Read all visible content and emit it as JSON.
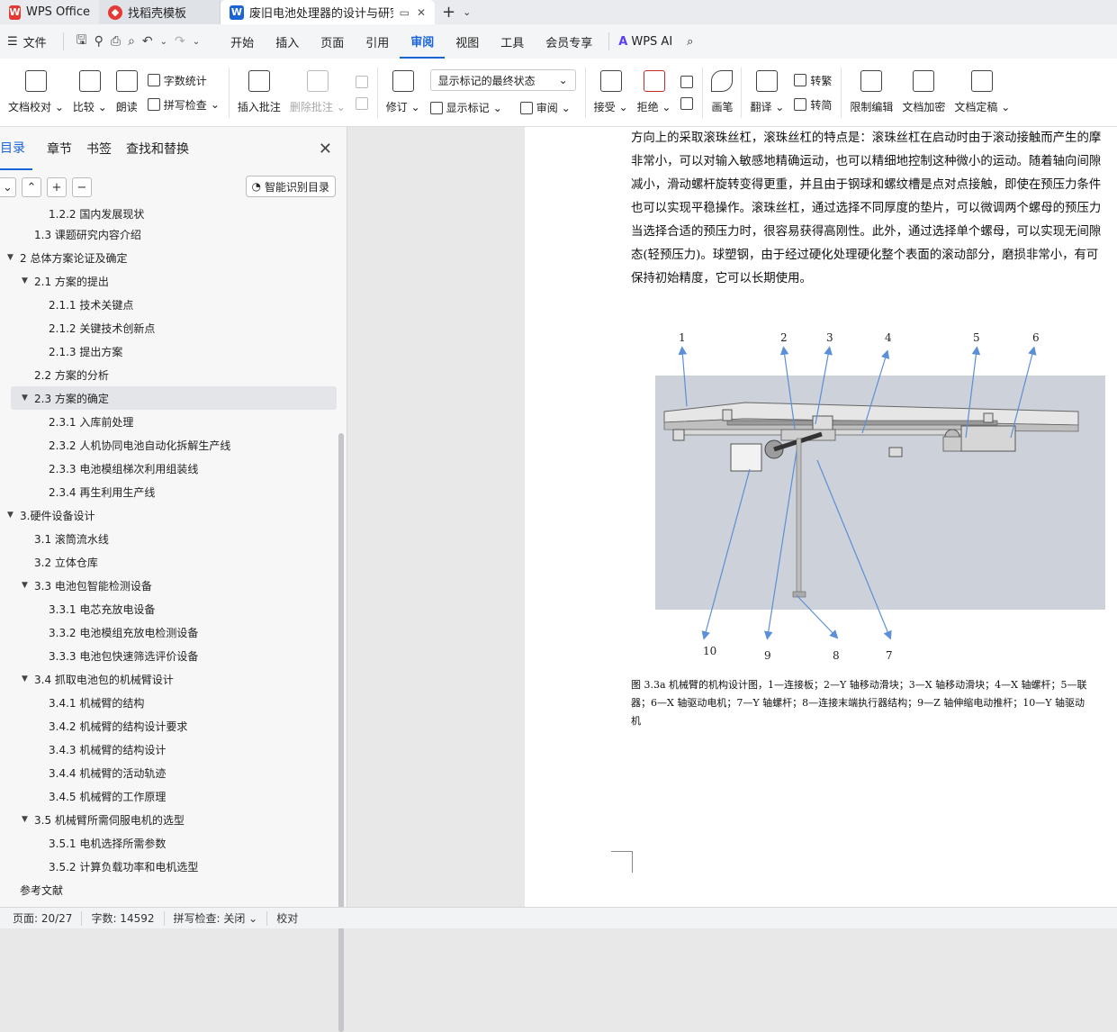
{
  "tabs": [
    {
      "label": "WPS Office",
      "icon": "wps-logo-icon"
    },
    {
      "label": "找稻壳模板",
      "icon": "docer-logo-icon"
    },
    {
      "label": "废旧电池处理器的设计与研究",
      "icon": "writer-logo-icon"
    }
  ],
  "menu": {
    "file": "文件",
    "items": [
      "开始",
      "插入",
      "页面",
      "引用",
      "审阅",
      "视图",
      "工具",
      "会员专享"
    ],
    "active": "审阅",
    "ai": "WPS AI"
  },
  "ribbon": {
    "doc_check": "文档校对",
    "compare": "比较",
    "read_aloud": "朗读",
    "word_count": "字数统计",
    "spell_check": "拼写检查",
    "insert_comment": "插入批注",
    "delete_comment": "删除批注",
    "revise": "修订",
    "markup_display": "显示标记的最终状态",
    "show_markup": "显示标记",
    "review": "审阅",
    "accept": "接受",
    "reject": "拒绝",
    "pen": "画笔",
    "translate": "翻译",
    "to_traditional": "转繁",
    "to_simplified": "转简",
    "restrict_edit": "限制编辑",
    "encrypt": "文档加密",
    "finalize": "文档定稿"
  },
  "nav": {
    "tabs": [
      "目录",
      "章节",
      "书签",
      "查找和替换"
    ],
    "active_tab": "目录",
    "smart_toc": "智能识别目录",
    "toc": [
      {
        "level": 3,
        "text": "1.2.2 国内发展现状",
        "arrow": false
      },
      {
        "level": 2,
        "text": "1.3  课题研究内容介绍",
        "arrow": false
      },
      {
        "level": 1,
        "text": "2  总体方案论证及确定",
        "arrow": true
      },
      {
        "level": 2,
        "text": "2.1 方案的提出",
        "arrow": true
      },
      {
        "level": 3,
        "text": "2.1.1 技术关键点",
        "arrow": false
      },
      {
        "level": 3,
        "text": "2.1.2 关键技术创新点",
        "arrow": false
      },
      {
        "level": 3,
        "text": "2.1.3 提出方案",
        "arrow": false
      },
      {
        "level": 2,
        "text": "2.2 方案的分析",
        "arrow": false
      },
      {
        "level": 2,
        "text": "2.3 方案的确定",
        "arrow": true,
        "selected": true
      },
      {
        "level": 3,
        "text": "2.3.1 入库前处理",
        "arrow": false
      },
      {
        "level": 3,
        "text": "2.3.2 人机协同电池自动化拆解生产线",
        "arrow": false
      },
      {
        "level": 3,
        "text": "2.3.3 电池模组梯次利用组装线",
        "arrow": false
      },
      {
        "level": 3,
        "text": "2.3.4 再生利用生产线",
        "arrow": false
      },
      {
        "level": 1,
        "text": "3.硬件设备设计",
        "arrow": true
      },
      {
        "level": 2,
        "text": "3.1 滚筒流水线",
        "arrow": false
      },
      {
        "level": 2,
        "text": "3.2 立体仓库",
        "arrow": false
      },
      {
        "level": 2,
        "text": "3.3 电池包智能检测设备",
        "arrow": true
      },
      {
        "level": 3,
        "text": "3.3.1 电芯充放电设备",
        "arrow": false
      },
      {
        "level": 3,
        "text": "3.3.2 电池模组充放电检测设备",
        "arrow": false
      },
      {
        "level": 3,
        "text": "3.3.3 电池包快速筛选评价设备",
        "arrow": false
      },
      {
        "level": 2,
        "text": "3.4 抓取电池包的机械臂设计",
        "arrow": true
      },
      {
        "level": 3,
        "text": "3.4.1 机械臂的结构",
        "arrow": false
      },
      {
        "level": 3,
        "text": "3.4.2 机械臂的结构设计要求",
        "arrow": false
      },
      {
        "level": 3,
        "text": "3.4.3 机械臂的结构设计",
        "arrow": false
      },
      {
        "level": 3,
        "text": "3.4.4 机械臂的活动轨迹",
        "arrow": false
      },
      {
        "level": 3,
        "text": "3.4.5 机械臂的工作原理",
        "arrow": false
      },
      {
        "level": 2,
        "text": "3.5 机械臂所需伺服电机的选型",
        "arrow": true
      },
      {
        "level": 3,
        "text": "3.5.1 电机选择所需参数",
        "arrow": false
      },
      {
        "level": 3,
        "text": "3.5.2 计算负载功率和电机选型",
        "arrow": false
      },
      {
        "level": 1,
        "text": "参考文献",
        "arrow": false
      }
    ]
  },
  "document": {
    "lines": [
      "方向上的采取滚珠丝杠，滚珠丝杠的特点是：滚珠丝杠在启动时由于滚动接触而产生的摩",
      "非常小，可以对输入敏感地精确运动，也可以精细地控制这种微小的运动。随着轴向间隙",
      "减小，滑动螺杆旋转变得更重，并且由于钢球和螺纹槽是点对点接触，即使在预压力条件",
      "也可以实现平稳操作。滚珠丝杠，通过选择不同厚度的垫片，可以微调两个螺母的预压力",
      "当选择合适的预压力时，很容易获得高刚性。此外，通过选择单个螺母，可以实现无间隙",
      "态(轻预压力)。球塑钢，由于经过硬化处理硬化整个表面的滚动部分，磨损非常小，有可",
      "保持初始精度，它可以长期使用。"
    ],
    "figure_labels_top": [
      "1",
      "2",
      "3",
      "4",
      "5",
      "6"
    ],
    "figure_labels_bottom": [
      "10",
      "9",
      "8",
      "7"
    ],
    "caption": [
      "图 3.3a  机械臂的机构设计图，1—连接板；2—Y 轴移动滑块；3—X 轴移动滑块；4—X 轴螺杆；5—联",
      "器；6—X 轴驱动电机；7—Y 轴螺杆；8—连接末端执行器结构；9—Z 轴伸缩电动推杆；10—Y 轴驱动",
      "机"
    ]
  },
  "status": {
    "page": "页面: 20/27",
    "words": "字数: 14592",
    "spell": "拼写检查: 关闭",
    "proof": "校对"
  }
}
